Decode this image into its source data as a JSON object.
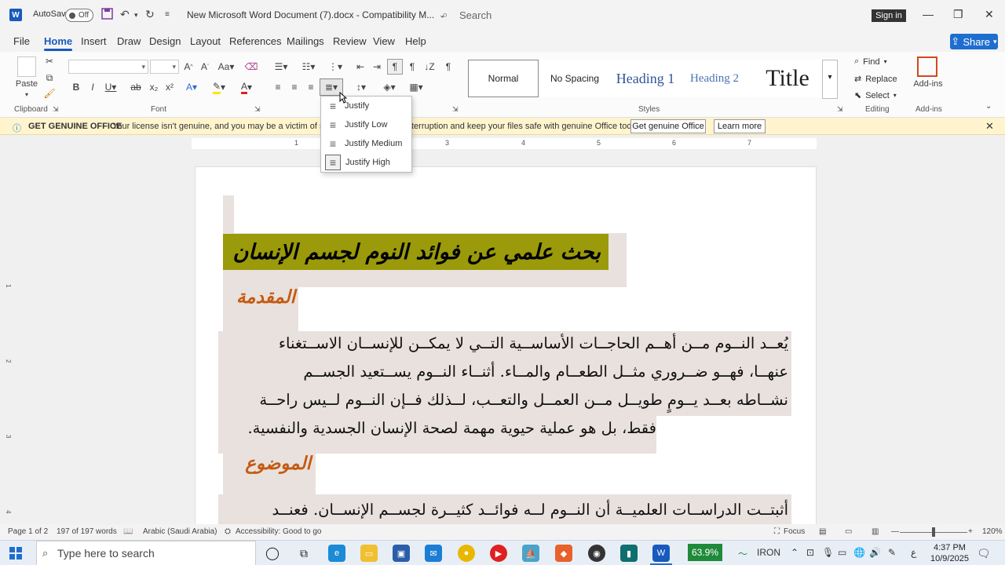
{
  "titlebar": {
    "autosave_label": "AutoSave",
    "autosave_state": "Off",
    "doc_title": "New Microsoft Word Document (7).docx  -  Compatibility M...",
    "search_placeholder": "Search",
    "signin_label": "Sign in"
  },
  "menu": {
    "tabs": [
      "File",
      "Home",
      "Insert",
      "Draw",
      "Design",
      "Layout",
      "References",
      "Mailings",
      "Review",
      "View",
      "Help"
    ],
    "active_tab": "Home",
    "share_label": "Share"
  },
  "ribbon": {
    "paste_label": "Paste",
    "groups": {
      "clipboard": "Clipboard",
      "font": "Font",
      "styles": "Styles",
      "editing": "Editing",
      "addins": "Add-ins"
    },
    "styles": [
      "Normal",
      "No Spacing",
      "Heading 1",
      "Heading 2",
      "Title"
    ],
    "editing": {
      "find": "Find",
      "replace": "Replace",
      "select": "Select"
    },
    "addins_label": "Add-ins"
  },
  "justify_menu": {
    "items": [
      "Justify",
      "Justify Low",
      "Justify Medium",
      "Justify High"
    ]
  },
  "notice": {
    "title": "GET GENUINE OFFICE",
    "message_left": "Your license isn't genuine, and you may be a victim of softw",
    "message_right": "terruption and keep your files safe with genuine Office today.",
    "btn_genuine": "Get genuine Office",
    "btn_learn": "Learn more"
  },
  "ruler": {
    "marks": [
      "1",
      "2",
      "3",
      "4",
      "5",
      "6",
      "7"
    ],
    "vmarks": [
      "1",
      "2",
      "3",
      "4"
    ]
  },
  "document": {
    "heading": "بحث علمي عن فوائد النوم لجسم الإنسان",
    "intro_title": "المقدمة",
    "intro_lines": [
      "يُعــد النــوم مــن أهــم الحاجــات الأساســية التــي لا يمكــن للإنســان الاســتغناء",
      "عنهــا، فهــو ضــروري مثــل الطعــام والمــاء. أثنــاء النــوم يســتعيد الجســم",
      "نشــاطه بعــد يــومٍ طويــل مــن العمــل والتعــب، لــذلك فــإن النــوم لــيس راحــة",
      "فقط، بل هو عملية حيوية مهمة لصحة الإنسان الجسدية والنفسية."
    ],
    "topic_title": "الموضوع",
    "topic_line": "أثبتــت الدراســات العلميــة أن النــوم لــه فوائــد كثيــرة لجســم الإنســان. فعنــد"
  },
  "status": {
    "page": "Page 1 of 2",
    "words": "197 of 197 words",
    "language": "Arabic (Saudi Arabia)",
    "accessibility": "Accessibility: Good to go",
    "focus": "Focus",
    "zoom": "120%"
  },
  "taskbar": {
    "search_placeholder": "Type here to search",
    "battery": "63.9%",
    "iron": "IRON",
    "time": "4:37 PM",
    "date": "10/9/2025"
  }
}
